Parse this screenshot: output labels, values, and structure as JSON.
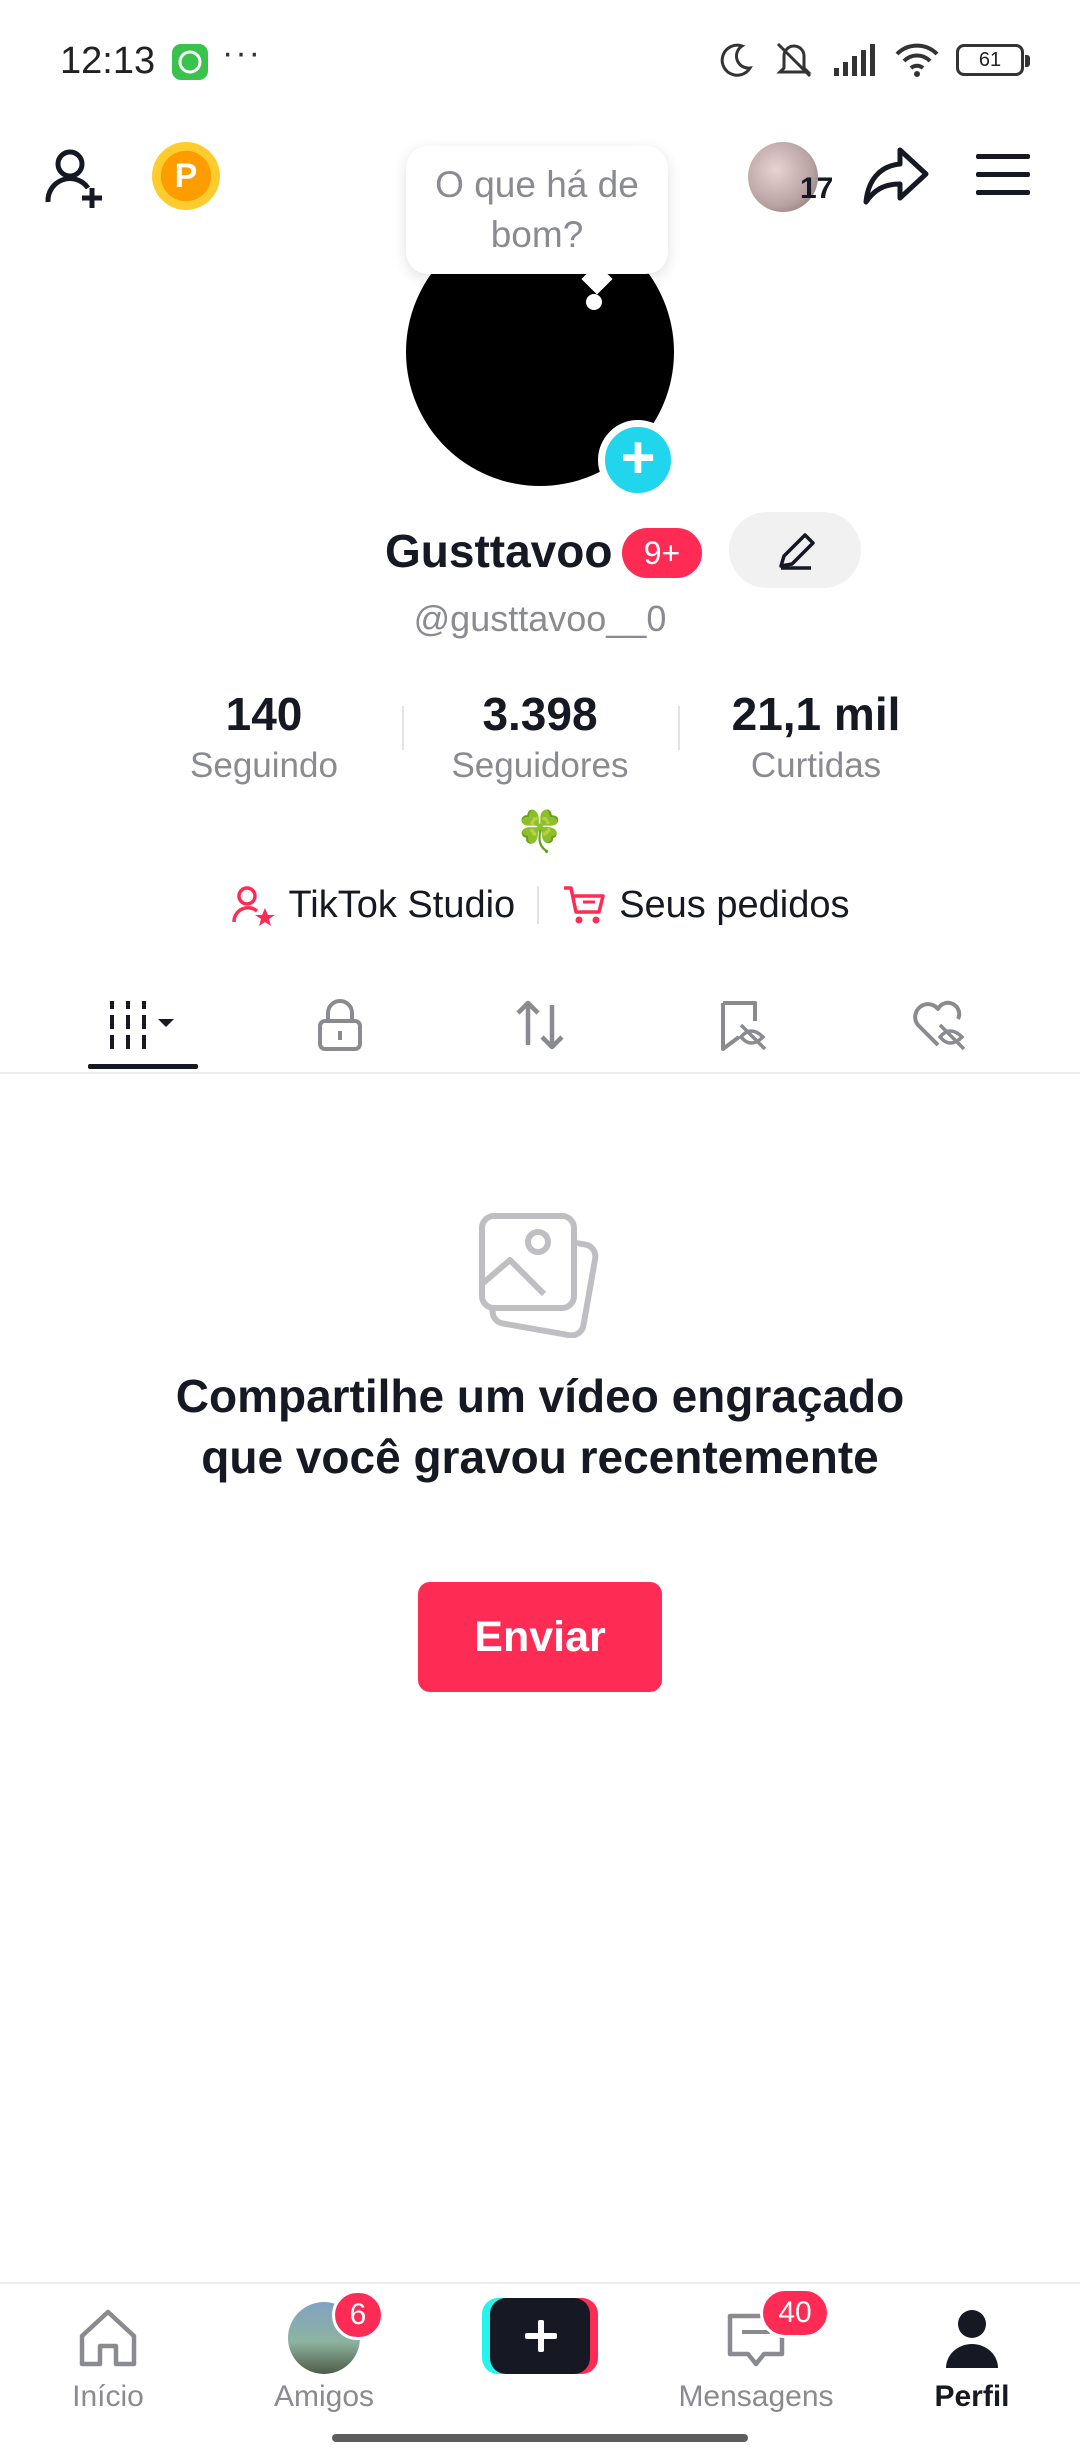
{
  "status_bar": {
    "time": "12:13",
    "more": "···",
    "battery": "61"
  },
  "header": {
    "coin_label": "P",
    "bubble_text": "O que há de bom?",
    "friends_count": "17"
  },
  "profile": {
    "display_name": "Gusttavoo",
    "notification_badge": "9+",
    "username": "@gusttavoo__0",
    "bio": "🍀"
  },
  "stats": [
    {
      "value": "140",
      "label": "Seguindo"
    },
    {
      "value": "3.398",
      "label": "Seguidores"
    },
    {
      "value": "21,1 mil",
      "label": "Curtidas"
    }
  ],
  "links": [
    {
      "label": "TikTok Studio",
      "icon": "person-star-icon"
    },
    {
      "label": "Seus pedidos",
      "icon": "cart-icon"
    }
  ],
  "tabs": [
    {
      "icon": "grid-dropdown-icon",
      "active": true
    },
    {
      "icon": "lock-icon",
      "active": false
    },
    {
      "icon": "repost-icon",
      "active": false
    },
    {
      "icon": "bookmark-hidden-icon",
      "active": false
    },
    {
      "icon": "heart-hidden-icon",
      "active": false
    }
  ],
  "empty_state": {
    "icon": "photos-icon",
    "message": "Compartilhe um vídeo engraçado que você gravou recentemente",
    "button_label": "Enviar"
  },
  "bottom_nav": [
    {
      "label": "Início",
      "icon": "home-icon",
      "badge": ""
    },
    {
      "label": "Amigos",
      "icon": "friends-avatar",
      "badge": "6"
    },
    {
      "label": "",
      "icon": "plus-icon",
      "badge": ""
    },
    {
      "label": "Mensagens",
      "icon": "inbox-icon",
      "badge": "40"
    },
    {
      "label": "Perfil",
      "icon": "profile-icon",
      "badge": ""
    }
  ],
  "colors": {
    "accent": "#fe2c55",
    "cyan": "#20d5ec",
    "text_primary": "#161823",
    "text_secondary": "#8a8b91"
  }
}
